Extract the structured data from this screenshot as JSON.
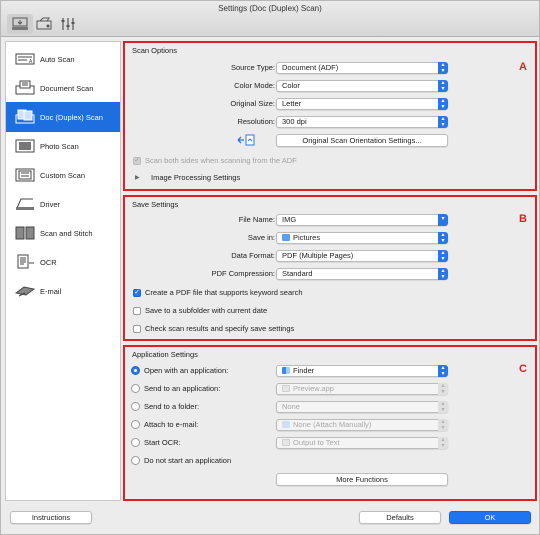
{
  "window": {
    "title": "Settings (Doc (Duplex) Scan)"
  },
  "toolbar": {
    "buttons": [
      "scan-from-computer-icon",
      "scan-from-panel-icon",
      "general-settings-icon"
    ]
  },
  "sidebar": {
    "items": [
      {
        "label": "Auto Scan",
        "icon": "auto-scan-icon",
        "selected": false
      },
      {
        "label": "Document Scan",
        "icon": "document-scan-icon",
        "selected": false
      },
      {
        "label": "Doc (Duplex) Scan",
        "icon": "duplex-scan-icon",
        "selected": true
      },
      {
        "label": "Photo Scan",
        "icon": "photo-scan-icon",
        "selected": false
      },
      {
        "label": "Custom Scan",
        "icon": "custom-scan-icon",
        "selected": false
      },
      {
        "label": "Driver",
        "icon": "driver-icon",
        "selected": false
      },
      {
        "label": "Scan and Stitch",
        "icon": "scan-stitch-icon",
        "selected": false
      },
      {
        "label": "OCR",
        "icon": "ocr-icon",
        "selected": false
      },
      {
        "label": "E-mail",
        "icon": "email-icon",
        "selected": false
      }
    ]
  },
  "scan_options": {
    "title": "Scan Options",
    "tag": "A",
    "source_type": {
      "label": "Source Type:",
      "value": "Document (ADF)"
    },
    "color_mode": {
      "label": "Color Mode:",
      "value": "Color"
    },
    "original_size": {
      "label": "Original Size:",
      "value": "Letter"
    },
    "resolution": {
      "label": "Resolution:",
      "value": "300 dpi"
    },
    "orientation_button": "Original Scan Orientation Settings...",
    "scan_both_sides": {
      "label": "Scan both sides when scanning from the ADF",
      "checked": true,
      "enabled": false
    },
    "image_processing": "Image Processing Settings"
  },
  "save_settings": {
    "title": "Save Settings",
    "tag": "B",
    "file_name": {
      "label": "File Name:",
      "value": "IMG"
    },
    "save_in": {
      "label": "Save in:",
      "value": "Pictures"
    },
    "data_format": {
      "label": "Data Format:",
      "value": "PDF (Multiple Pages)"
    },
    "pdf_compression": {
      "label": "PDF Compression:",
      "value": "Standard"
    },
    "keyword_search": {
      "label": "Create a PDF file that supports keyword search",
      "checked": true
    },
    "subfolder": {
      "label": "Save to a subfolder with current date",
      "checked": false
    },
    "check_results": {
      "label": "Check scan results and specify save settings",
      "checked": false
    }
  },
  "app_settings": {
    "title": "Application Settings",
    "tag": "C",
    "open_app": {
      "label": "Open with an application:",
      "value": "Finder",
      "selected": true
    },
    "send_app": {
      "label": "Send to an application:",
      "value": "Preview.app"
    },
    "send_folder": {
      "label": "Send to a folder:",
      "value": "None"
    },
    "attach_email": {
      "label": "Attach to e-mail:",
      "value": "None (Attach Manually)"
    },
    "start_ocr": {
      "label": "Start OCR:",
      "value": "Output to Text"
    },
    "no_app": {
      "label": "Do not start an application"
    },
    "more_functions": "More Functions"
  },
  "footer": {
    "instructions": "Instructions",
    "defaults": "Defaults",
    "ok": "OK"
  },
  "colors": {
    "accent": "#1f74f0",
    "highlight_border": "#e02020",
    "selected_item": "#1d6fe0"
  }
}
